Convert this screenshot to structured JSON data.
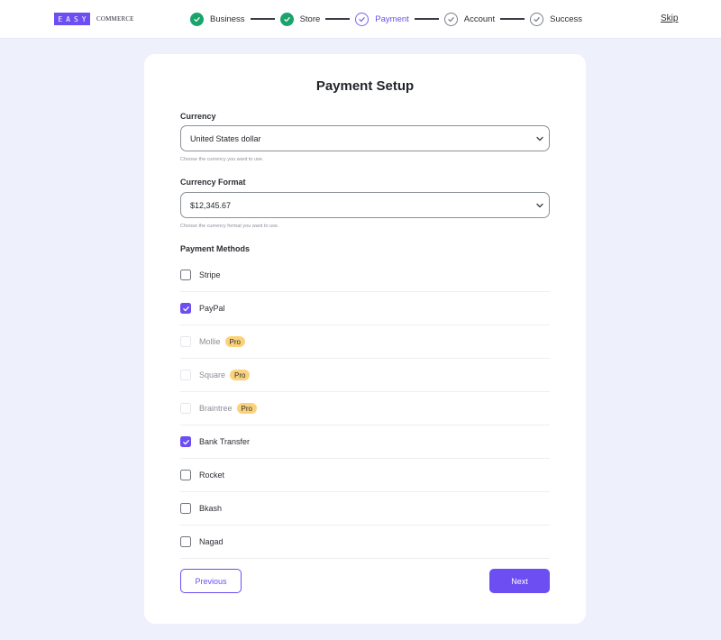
{
  "header": {
    "logo_mark": "EASY",
    "logo_word": "COMMERCE",
    "skip_label": "Skip",
    "steps": [
      {
        "label": "Business",
        "state": "done"
      },
      {
        "label": "Store",
        "state": "done"
      },
      {
        "label": "Payment",
        "state": "current"
      },
      {
        "label": "Account",
        "state": "pending"
      },
      {
        "label": "Success",
        "state": "pending"
      }
    ]
  },
  "form": {
    "title": "Payment Setup",
    "currency": {
      "label": "Currency",
      "value": "United States dollar",
      "help": "Choose the currency you want to use."
    },
    "currency_format": {
      "label": "Currency Format",
      "value": "$12,345.67",
      "help": "Choose the currency format you want to use."
    },
    "payment_methods_label": "Payment Methods",
    "pro_badge": "Pro",
    "methods": [
      {
        "label": "Stripe",
        "checked": false,
        "pro": false
      },
      {
        "label": "PayPal",
        "checked": true,
        "pro": false
      },
      {
        "label": "Mollie",
        "checked": false,
        "pro": true
      },
      {
        "label": "Square",
        "checked": false,
        "pro": true
      },
      {
        "label": "Braintree",
        "checked": false,
        "pro": true
      },
      {
        "label": "Bank Transfer",
        "checked": true,
        "pro": false
      },
      {
        "label": "Rocket",
        "checked": false,
        "pro": false
      },
      {
        "label": "Bkash",
        "checked": false,
        "pro": false
      },
      {
        "label": "Nagad",
        "checked": false,
        "pro": false
      }
    ],
    "previous_label": "Previous",
    "next_label": "Next"
  },
  "colors": {
    "accent": "#6c4ef2",
    "step_done": "#1aa36b",
    "pro_badge": "#fbd27a",
    "page_bg": "#eef0fb"
  },
  "icons": {
    "step_done": "check-icon",
    "step_current": "check-outline-icon",
    "select": "chevron-down-icon",
    "checkbox_checked": "check-icon"
  }
}
